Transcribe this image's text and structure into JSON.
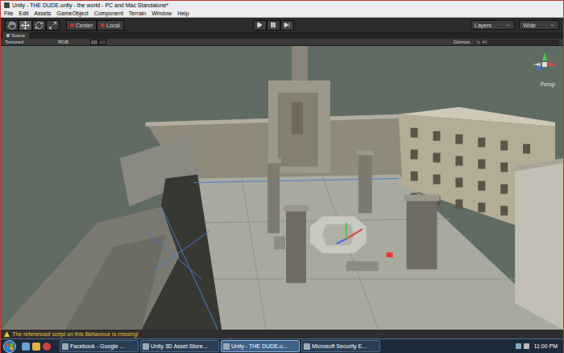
{
  "window": {
    "title": "Unity - THE DUDE.unity - the world - PC and Mac Standalone*"
  },
  "menu": [
    "File",
    "Edit",
    "Assets",
    "GameObject",
    "Component",
    "Terrain",
    "Window",
    "Help"
  ],
  "toolbar": {
    "tools": [
      {
        "kind": "hand",
        "selected": false
      },
      {
        "kind": "move",
        "selected": true
      },
      {
        "kind": "rotate",
        "selected": false
      },
      {
        "kind": "scale",
        "selected": false
      }
    ],
    "pivot": "Center",
    "space": "Local",
    "layers": "Layers",
    "layout": "Wide"
  },
  "scene_view": {
    "tab": "Scene",
    "render_mode": "Textured",
    "channels": "RGB",
    "gizmos": "Gizmos",
    "search_placeholder": "All",
    "projection": "Persp"
  },
  "status_bar": {
    "message": "The referenced script on this Behaviour is missing!"
  },
  "taskbar": {
    "tasks": [
      {
        "label": "Facebook - Google ...",
        "selected": false
      },
      {
        "label": "Unity 3D Asset Store...",
        "selected": false
      },
      {
        "label": "Unity - THE DUDE.u...",
        "selected": true
      },
      {
        "label": "Microsoft Security E...",
        "selected": false
      }
    ],
    "clock": "11:00 PM"
  }
}
